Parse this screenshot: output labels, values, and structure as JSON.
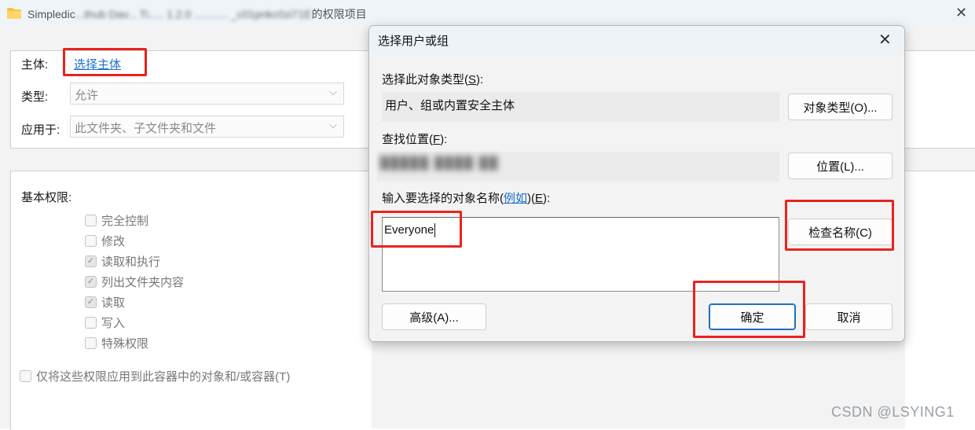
{
  "background_window": {
    "title_prefix": "Simpledic",
    "title_blurred": "...thub Dav... Ti.....  1.2.0 ...........  _c01pnkc0zi71E",
    "title_suffix": "的权限项目",
    "principal_label": "主体:",
    "principal_link": "选择主体",
    "type_label": "类型:",
    "type_value": "允许",
    "applies_to_label": "应用于:",
    "applies_to_value": "此文件夹、子文件夹和文件",
    "basic_permissions_label": "基本权限:",
    "permissions": [
      {
        "label": "完全控制",
        "checked": false
      },
      {
        "label": "修改",
        "checked": false
      },
      {
        "label": "读取和执行",
        "checked": true
      },
      {
        "label": "列出文件夹内容",
        "checked": true
      },
      {
        "label": "读取",
        "checked": true
      },
      {
        "label": "写入",
        "checked": false
      },
      {
        "label": "特殊权限",
        "checked": false
      }
    ],
    "apply_only_label": "仅将这些权限应用到此容器中的对象和/或容器(T)"
  },
  "dialog": {
    "title": "选择用户或组",
    "object_types_label": "选择此对象类型(",
    "object_types_key": "S",
    "object_types_label_end": "):",
    "object_types_value": "用户、组或内置安全主体",
    "object_types_button": "对象类型(O)...",
    "location_label": "查找位置(",
    "location_key": "F",
    "location_label_end": "):",
    "location_value_blurred": "█████ ████ ██",
    "location_button": "位置(L)...",
    "enter_names_label": "输入要选择的对象名称(",
    "examples_link": "例如",
    "enter_names_label_mid": ")(",
    "enter_names_key": "E",
    "enter_names_label_end": "):",
    "enter_names_value": "Everyone",
    "check_names_button": "检查名称(C)",
    "advanced_button": "高级(A)...",
    "ok_button": "确定",
    "cancel_button": "取消"
  },
  "watermark": "CSDN @LSYING1",
  "colors": {
    "highlight_red": "#e8231f",
    "link_blue": "#1a6fd1",
    "default_button_border": "#1f6fbf"
  }
}
